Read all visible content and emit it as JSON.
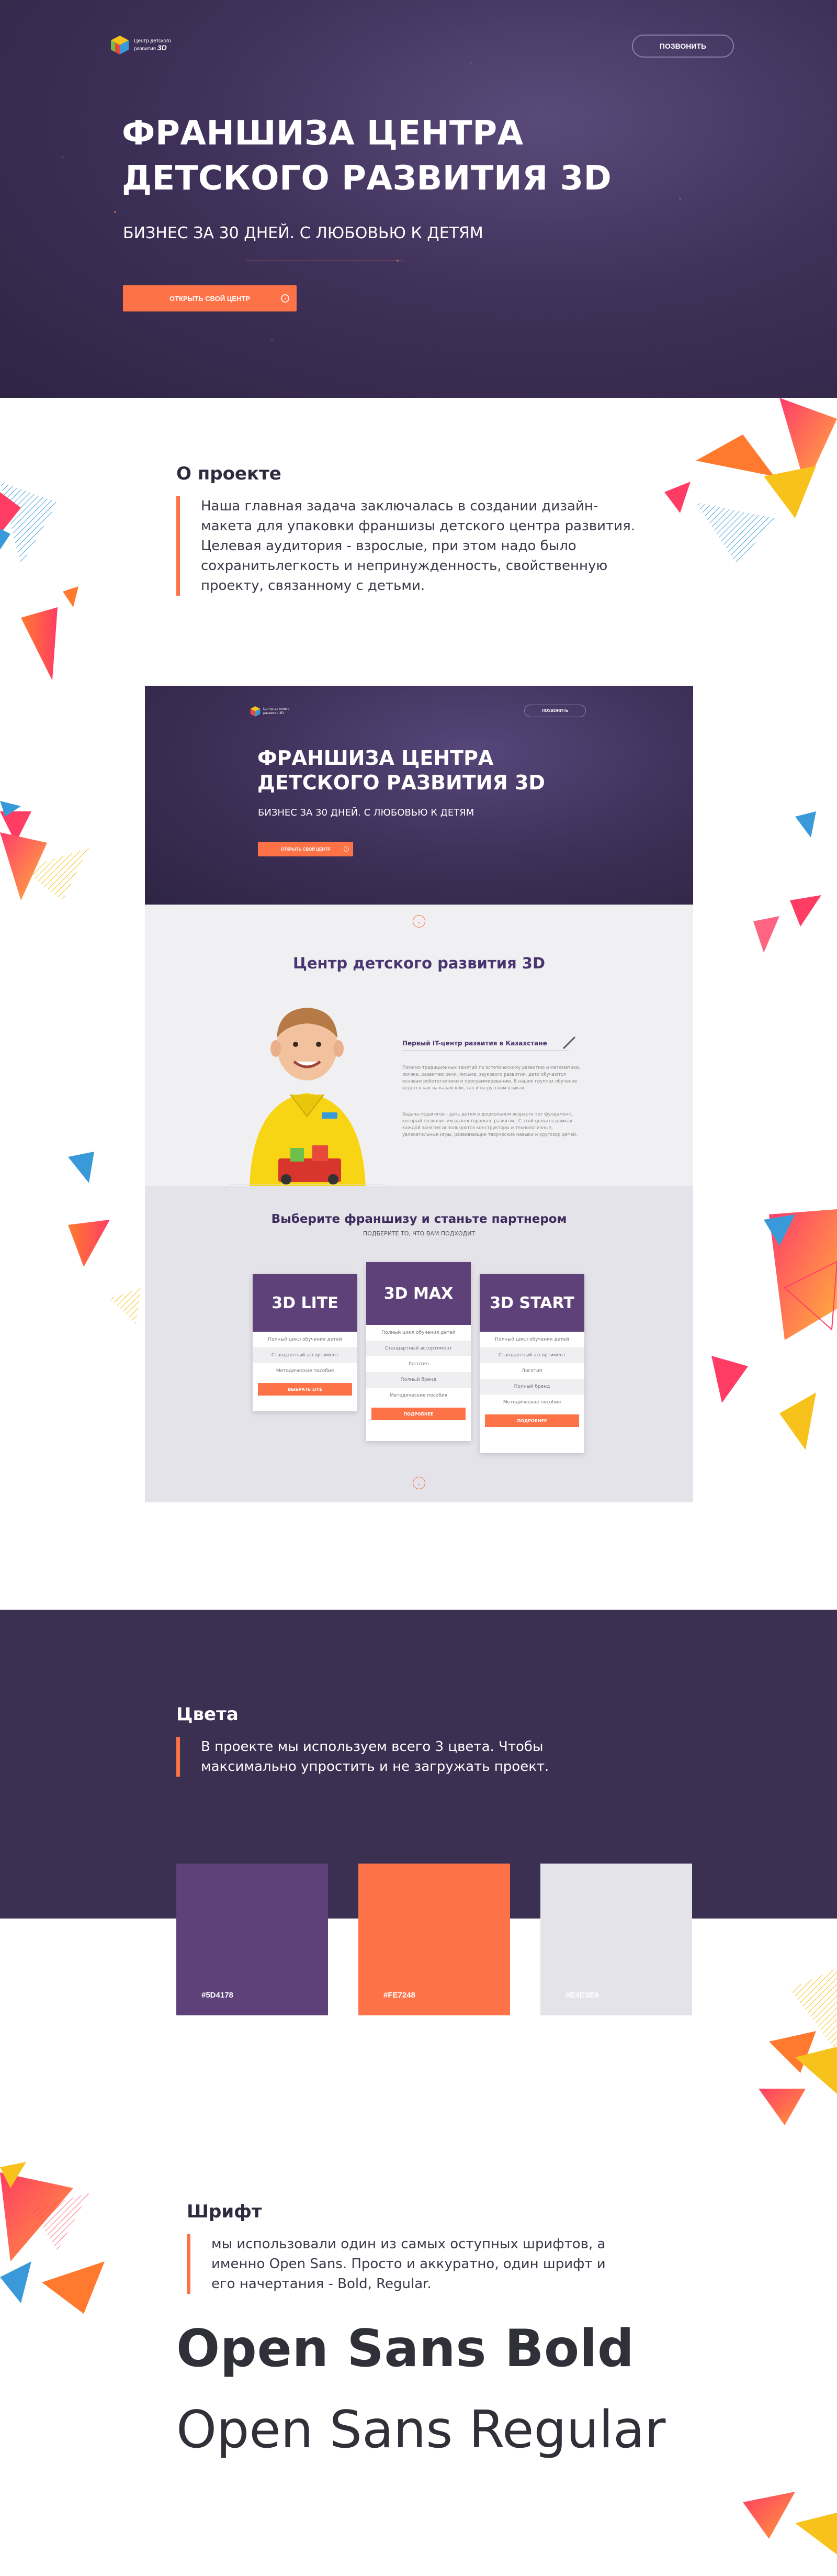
{
  "hero": {
    "logo_line1": "Центр детского",
    "logo_line2": "развития",
    "logo_3d": "3D",
    "call_label": "ПОЗВОНИТЬ",
    "title_line1": "ФРАНШИЗА ЦЕНТРА",
    "title_line2": "ДЕТСКОГО РАЗВИТИЯ 3D",
    "subtitle": "БИЗНЕС ЗА 30 ДНЕЙ. С ЛЮБОВЬЮ К ДЕТЯМ",
    "cta_label": "ОТКРЫТЬ СВОЙ ЦЕНТР"
  },
  "about": {
    "heading": "О проекте",
    "text": "Наша главная задача заключалась в создании дизайн-макета для упаковки франшизы детского центра развития. Целевая аудитория - взрослые, при этом надо было сохранитьлегкость и непринужденность, свойственную проекту, связанному с детьми."
  },
  "mockup": {
    "hero": {
      "logo_line1": "Центр детского",
      "logo_line2": "развития 3D",
      "call_label": "ПОЗВОНИТЬ",
      "title_line1": "ФРАНШИЗА ЦЕНТРА",
      "title_line2": "ДЕТСКОГО РАЗВИТИЯ 3D",
      "subtitle": "БИЗНЕС ЗА 30 ДНЕЙ. С ЛЮБОВЬЮ К ДЕТЯМ",
      "cta_label": "ОТКРЫТЬ СВОЙ ЦЕНТР"
    },
    "centre": {
      "heading": "Центр детского развития 3D",
      "tagline": "Первый  IT-центр развития в Казахстане",
      "para1": "Помимо традиционных занятий по эстетическому развитию и математике, логике, развитию речи, письма, звукового развития, дети обучаются основам робототехники и программированию. В наших группах обучение ведется как на казахском, так и на русском языках.",
      "para2": "Задача педагогов - дать детям в дошкольном возрасте тот фундамент, который позволит им разностороннее развитие. С этой целью в рамках каждой занятия используются конструкторы и технологичные, увлекательные игры, развивающие творческие навыки и кругозор детей."
    },
    "plans": {
      "heading": "Выберите франшизу и станьте партнером",
      "subheading": "ПОДБЕРИТЕ ТО, ЧТО ВАМ ПОДХОДИТ",
      "items": [
        {
          "name": "3D LITE",
          "rows": [
            "Полный цикл обучения детей",
            "Стандартный ассортимент",
            "Методические пособия"
          ],
          "button": "ВЫБРАТЬ LITE"
        },
        {
          "name": "3D MAX",
          "rows": [
            "Полный цикл обучения детей",
            "Стандартный ассортимент",
            "Логотип",
            "Полный бренд",
            "Методические пособия"
          ],
          "button": "ПОДРОБНЕЕ"
        },
        {
          "name": "3D START",
          "rows": [
            "Полный цикл обучения детей",
            "Стандартный ассортимент",
            "Логотип",
            "Полный бренд",
            "Методические пособия"
          ],
          "button": "ПОДРОБНЕЕ"
        }
      ]
    }
  },
  "colors": {
    "heading": "Цвета",
    "text": "В проекте мы используем всего 3 цвета. Чтобы максимально упростить и не загружать проект.",
    "swatches": [
      {
        "hex": "#5D4178",
        "color": "#5d4178"
      },
      {
        "hex": "#FE7248",
        "color": "#fe7248"
      },
      {
        "hex": "#E4E3E9",
        "color": "#e4e3e9"
      }
    ]
  },
  "font": {
    "heading": "Шрифт",
    "text": "мы использовали один из самых оступных шрифтов, а именно Open Sans. Просто и аккуратно, один шрифт и его начертания - Bold, Regular.",
    "sample_bold": "Open Sans Bold",
    "sample_regular": "Open Sans Regular"
  },
  "palette": {
    "purple": "#5d4178",
    "orange": "#fe7248",
    "light": "#e4e3e9",
    "dark": "#3b2f52"
  }
}
